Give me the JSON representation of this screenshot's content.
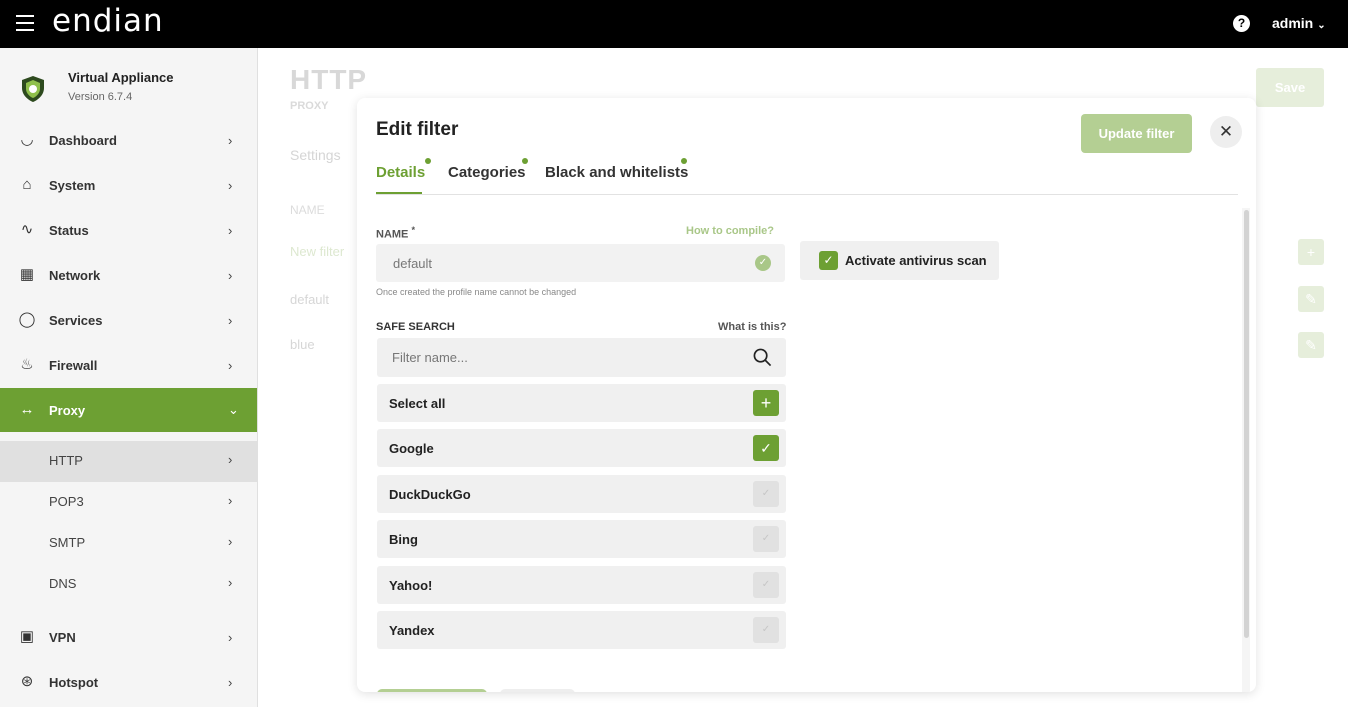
{
  "topbar": {
    "brand": "endian",
    "help_glyph": "?",
    "user": "admin"
  },
  "sidebar": {
    "appliance_name": "Virtual Appliance",
    "version": "Version 6.7.4",
    "items": [
      {
        "label": "Dashboard",
        "icon": "gauge-icon"
      },
      {
        "label": "System",
        "icon": "home-icon"
      },
      {
        "label": "Status",
        "icon": "pulse-icon"
      },
      {
        "label": "Network",
        "icon": "network-icon"
      },
      {
        "label": "Services",
        "icon": "drop-icon"
      },
      {
        "label": "Firewall",
        "icon": "flame-icon"
      },
      {
        "label": "Proxy",
        "icon": "proxy-arrows-icon"
      },
      {
        "label": "VPN",
        "icon": "lock-icon"
      },
      {
        "label": "Hotspot",
        "icon": "wireless-icon"
      }
    ],
    "sub_items": [
      "HTTP",
      "POP3",
      "SMTP",
      "DNS"
    ]
  },
  "page": {
    "title": "HTTP",
    "subtitle": "PROXY",
    "save_label": "Save",
    "settings_label": "Settings",
    "column_name": "NAME",
    "rows": [
      "New filter",
      "default",
      "blue"
    ]
  },
  "modal": {
    "title": "Edit filter",
    "update_label": "Update filter",
    "tabs": [
      "Details",
      "Categories",
      "Black and whitelists"
    ],
    "name_label": "NAME",
    "name_required": "*",
    "how_link": "How to compile?",
    "name_value": "default",
    "name_hint": "Once created the profile name cannot be changed",
    "antivirus_label": "Activate antivirus scan",
    "safe_search_label": "SAFE SEARCH",
    "what_link": "What is this?",
    "search_placeholder": "Filter name...",
    "select_all": "Select all",
    "engines": [
      {
        "label": "Google",
        "checked": true
      },
      {
        "label": "DuckDuckGo",
        "checked": false
      },
      {
        "label": "Bing",
        "checked": false
      },
      {
        "label": "Yahoo!",
        "checked": false
      },
      {
        "label": "Yandex",
        "checked": false
      }
    ]
  },
  "colors": {
    "accent": "#6da033",
    "accent_light": "#b4cf93",
    "topbar": "#000000"
  }
}
